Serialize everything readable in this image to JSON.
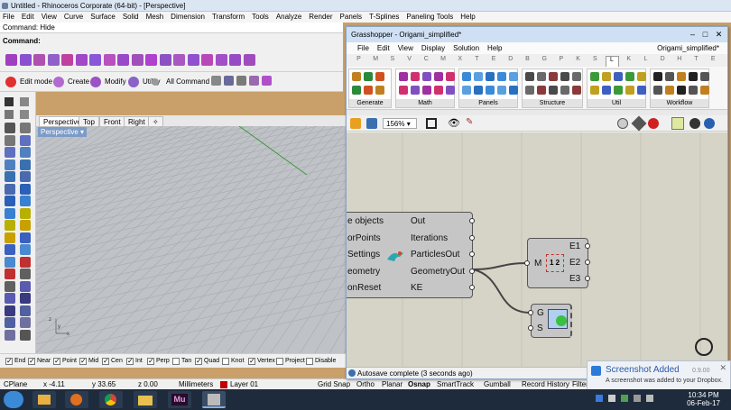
{
  "rhino": {
    "title": "Untitled - Rhinoceros Corporate (64-bit) - [Perspective]",
    "menu": [
      "File",
      "Edit",
      "View",
      "Curve",
      "Surface",
      "Solid",
      "Mesh",
      "Dimension",
      "Transform",
      "Tools",
      "Analyze",
      "Render",
      "Panels",
      "T-Splines",
      "Paneling Tools",
      "Help"
    ],
    "command_history": "Command: Hide",
    "command_prompt": "Command:",
    "toolbar2": {
      "edit_mode": "Edit mode",
      "create": "Create",
      "modify": "Modify",
      "utility": "Utility",
      "all_command": "All Command"
    },
    "viewport_tabs": [
      "Perspective",
      "Top",
      "Front",
      "Right"
    ],
    "viewport_label": "Perspective",
    "osnaps": [
      {
        "label": "End",
        "checked": true
      },
      {
        "label": "Near",
        "checked": true
      },
      {
        "label": "Point",
        "checked": true
      },
      {
        "label": "Mid",
        "checked": true
      },
      {
        "label": "Cen",
        "checked": true
      },
      {
        "label": "Int",
        "checked": true
      },
      {
        "label": "Perp",
        "checked": true
      },
      {
        "label": "Tan",
        "checked": false
      },
      {
        "label": "Quad",
        "checked": true
      },
      {
        "label": "Knot",
        "checked": false
      },
      {
        "label": "Vertex",
        "checked": true
      },
      {
        "label": "Project",
        "checked": false
      },
      {
        "label": "Disable",
        "checked": false
      }
    ],
    "status": {
      "cplane": "CPlane",
      "x": "x -4.11",
      "y": "y 33.65",
      "z": "z 0.00",
      "units": "Millimeters",
      "layer": "Layer 01",
      "layer_color": "#c00000",
      "grid_snap": "Grid Snap",
      "ortho": "Ortho",
      "planar": "Planar",
      "osnap": "Osnap",
      "smarttrack": "SmartTrack",
      "gumball": "Gumball",
      "record_history": "Record History",
      "filter": "Filter"
    }
  },
  "grasshopper": {
    "title": "Grasshopper - Origami_simplified*",
    "menu": [
      "File",
      "Edit",
      "View",
      "Display",
      "Solution",
      "Help"
    ],
    "doc_name": "Origami_simplified*",
    "tabs": [
      "P",
      "M",
      "S",
      "V",
      "C",
      "M",
      "X",
      "T",
      "E",
      "D",
      "B",
      "G",
      "P",
      "K",
      "S",
      "L",
      "K",
      "L",
      "D",
      "H",
      "T",
      "E"
    ],
    "active_tab_index": 15,
    "groups": [
      "Generate",
      "Math",
      "Panels",
      "Structure",
      "Util",
      "Workflow"
    ],
    "zoom": "156%",
    "component1": {
      "inputs": [
        "e objects",
        "orPoints",
        "Settings",
        "eometry",
        "onReset"
      ],
      "outputs": [
        "Out",
        "Iterations",
        "ParticlesOut",
        "GeometryOut",
        "KE"
      ]
    },
    "component2": {
      "input": "M",
      "outputs": [
        "E1",
        "E2",
        "E3"
      ]
    },
    "component3": {
      "inputs": [
        "G",
        "S"
      ]
    },
    "status": "Autosave complete (3 seconds ago)",
    "version": "0.9.00"
  },
  "notification": {
    "title": "Screenshot Added",
    "body": "A screenshot was added to your Dropbox."
  },
  "taskbar": {
    "time": "10:34 PM",
    "date": "06-Feb-17"
  }
}
